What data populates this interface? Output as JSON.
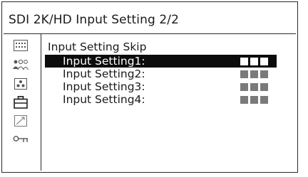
{
  "header": {
    "title": "SDI 2K/HD Input Setting 2/2"
  },
  "sidebar": {
    "icons": [
      "menu-grid-icon",
      "users-icon",
      "dots-icon",
      "briefcase-icon",
      "trend-arrow-icon",
      "key-icon"
    ]
  },
  "main": {
    "section_title": "Input Setting Skip",
    "rows": [
      {
        "label": "Input Setting1:",
        "value": "■■■",
        "selected": true
      },
      {
        "label": "Input Setting2:",
        "value": "■■■",
        "selected": false
      },
      {
        "label": "Input Setting3:",
        "value": "■■■",
        "selected": false
      },
      {
        "label": "Input Setting4:",
        "value": "■■■",
        "selected": false
      }
    ]
  }
}
